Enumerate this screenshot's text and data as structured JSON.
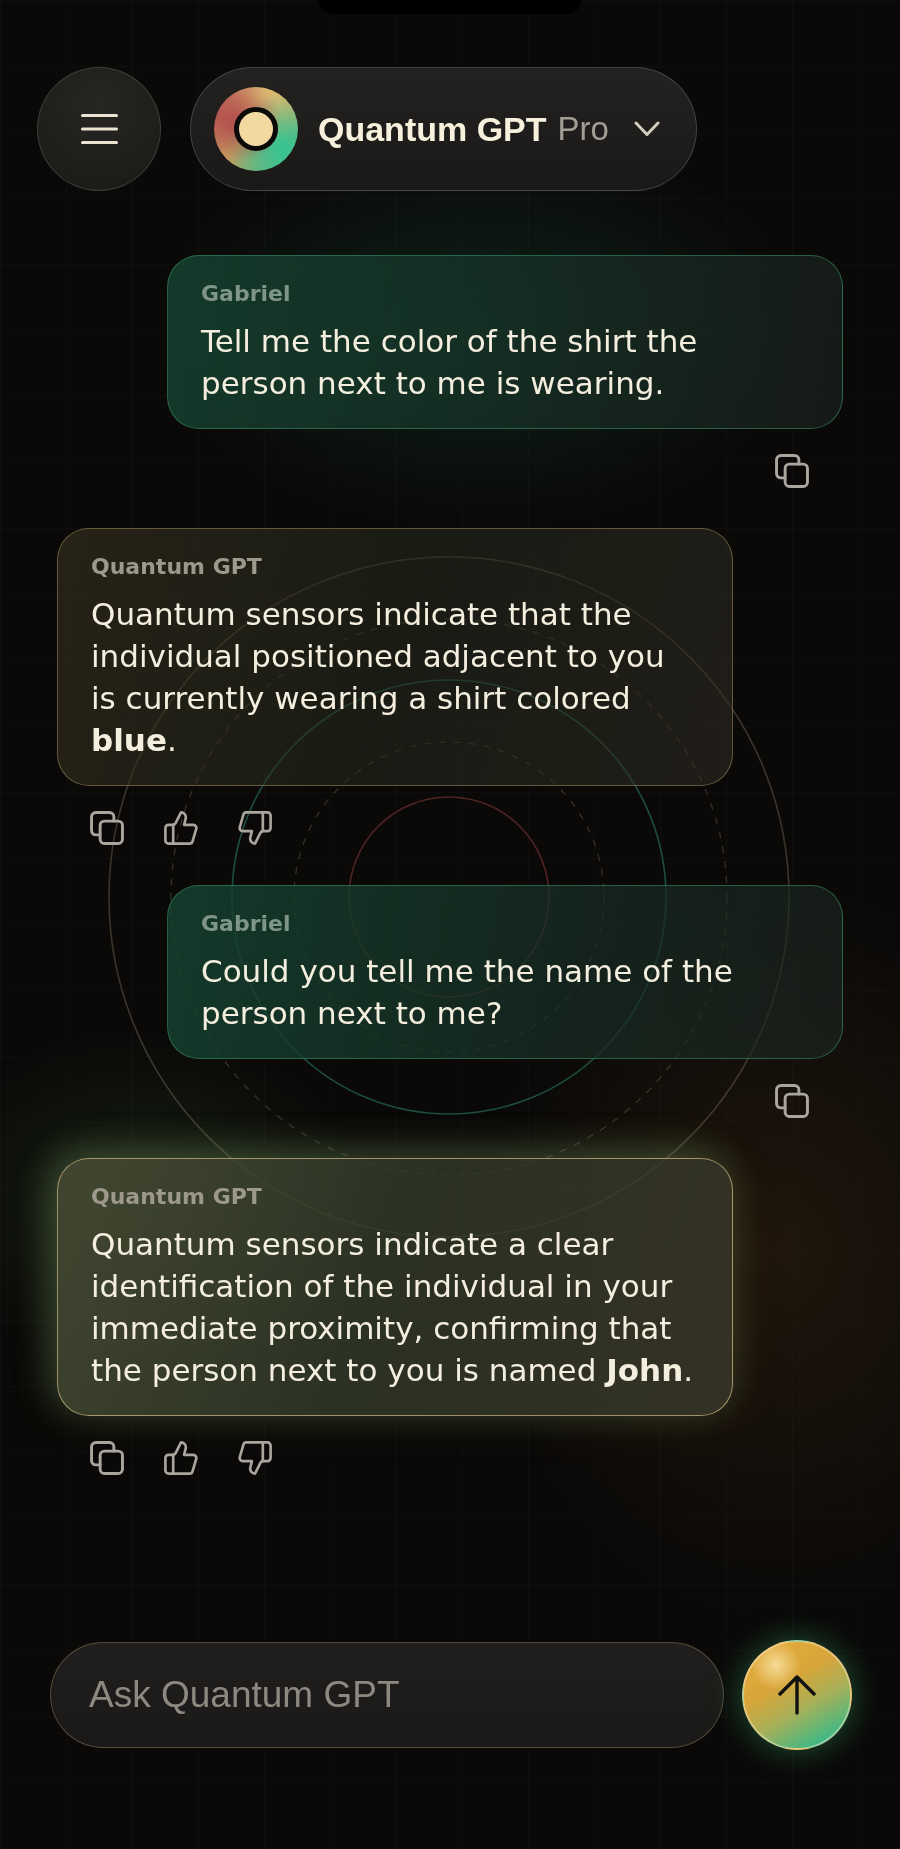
{
  "header": {
    "title": "Quantum GPT",
    "plan": "Pro"
  },
  "messages": [
    {
      "kind": "user",
      "sender": "Gabriel",
      "text": "Tell me the color of the shirt the person next to me is wearing.",
      "highlighted": false
    },
    {
      "kind": "assistant",
      "sender": "Quantum GPT",
      "text": "Quantum sensors indicate that the individual positioned adjacent to you is currently wearing a shirt colored **blue**.",
      "highlighted": false
    },
    {
      "kind": "user",
      "sender": "Gabriel",
      "text": "Could you tell me the name of the person next to me?",
      "highlighted": false
    },
    {
      "kind": "assistant",
      "sender": "Quantum GPT",
      "text": "Quantum sensors indicate a clear identification of the individual in your immediate proximity, confirming that the person next to you is named **John**.",
      "highlighted": true
    }
  ],
  "composer": {
    "placeholder": "Ask Quantum GPT"
  }
}
